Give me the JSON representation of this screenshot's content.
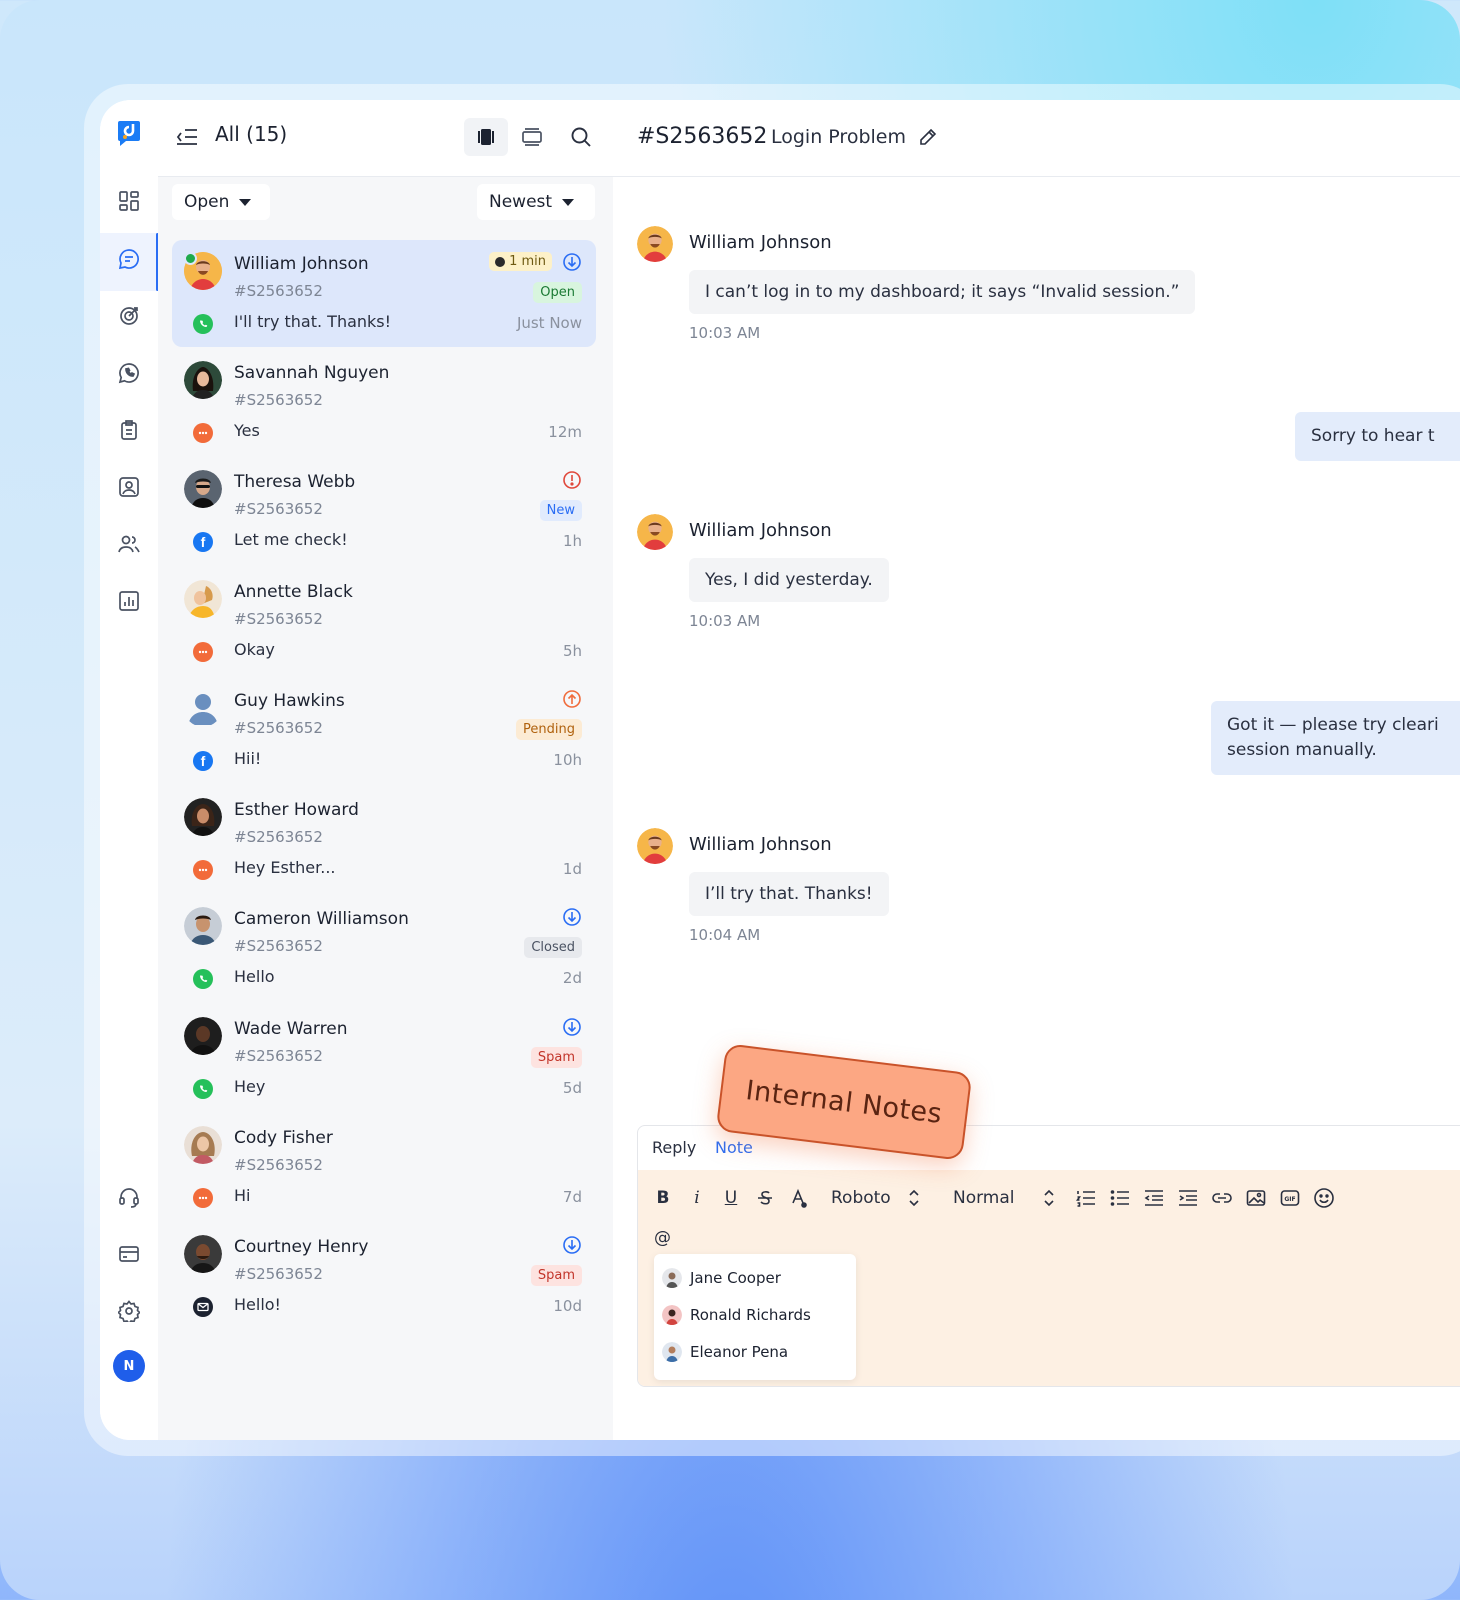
{
  "list": {
    "title": "All (15)",
    "status_filter": "Open",
    "sort_filter": "Newest"
  },
  "conversations": [
    {
      "name": "William Johnson",
      "ticket": "#S2563652",
      "message": "I'll try that. Thanks!",
      "time": "Just Now",
      "badge": "Open",
      "timer": "1 min",
      "channel": "whatsapp"
    },
    {
      "name": "Savannah Nguyen",
      "ticket": "#S2563652",
      "message": "Yes",
      "time": "12m",
      "badge": "",
      "channel": "chat"
    },
    {
      "name": "Theresa Webb",
      "ticket": "#S2563652",
      "message": "Let me check!",
      "time": "1h",
      "badge": "New",
      "channel": "facebook"
    },
    {
      "name": "Annette Black",
      "ticket": "#S2563652",
      "message": "Okay",
      "time": "5h",
      "badge": "",
      "channel": "chat"
    },
    {
      "name": "Guy Hawkins",
      "ticket": "#S2563652",
      "message": "Hii!",
      "time": "10h",
      "badge": "Pending",
      "channel": "facebook"
    },
    {
      "name": "Esther Howard",
      "ticket": "#S2563652",
      "message": "Hey Esther...",
      "time": "1d",
      "badge": "",
      "channel": "chat"
    },
    {
      "name": "Cameron Williamson",
      "ticket": "#S2563652",
      "message": "Hello",
      "time": "2d",
      "badge": "Closed",
      "channel": "whatsapp"
    },
    {
      "name": "Wade Warren",
      "ticket": "#S2563652",
      "message": "Hey",
      "time": "5d",
      "badge": "Spam",
      "channel": "whatsapp"
    },
    {
      "name": "Cody Fisher",
      "ticket": "#S2563652",
      "message": "Hi",
      "time": "7d",
      "badge": "",
      "channel": "chat"
    },
    {
      "name": "Courtney Henry",
      "ticket": "#S2563652",
      "message": "Hello!",
      "time": "10d",
      "badge": "Spam",
      "channel": "email"
    }
  ],
  "chat": {
    "ticket": "#S2563652",
    "subject": "Login Problem",
    "messages": [
      {
        "author": "William Johnson",
        "text": "I can’t log in to my dashboard; it says “Invalid session.”",
        "time": "10:03 AM"
      },
      {
        "text": "Sorry to hear t"
      },
      {
        "author": "William Johnson",
        "text": "Yes, I did yesterday.",
        "time": "10:03 AM"
      },
      {
        "text_line1": "Got it — please try cleari",
        "text_line2": "session manually."
      },
      {
        "author": "William Johnson",
        "text": "I’ll try that. Thanks!",
        "time": "10:04 AM"
      }
    ]
  },
  "composer": {
    "tab_reply": "Reply",
    "tab_note": "Note",
    "toolbar": {
      "bold": "B",
      "italic": "i",
      "underline": "U",
      "font": "Roboto",
      "size": "Normal"
    },
    "mention_trigger": "@",
    "mentions": [
      "Jane Cooper",
      "Ronald Richards",
      "Eleanor Pena"
    ]
  },
  "sticker": "Internal Notes",
  "user_initial": "N",
  "colors": {
    "accent": "#2a6df4",
    "selected_row": "#dde7fb",
    "note_bg": "#fdf0e3",
    "sticker": "#fca783"
  }
}
